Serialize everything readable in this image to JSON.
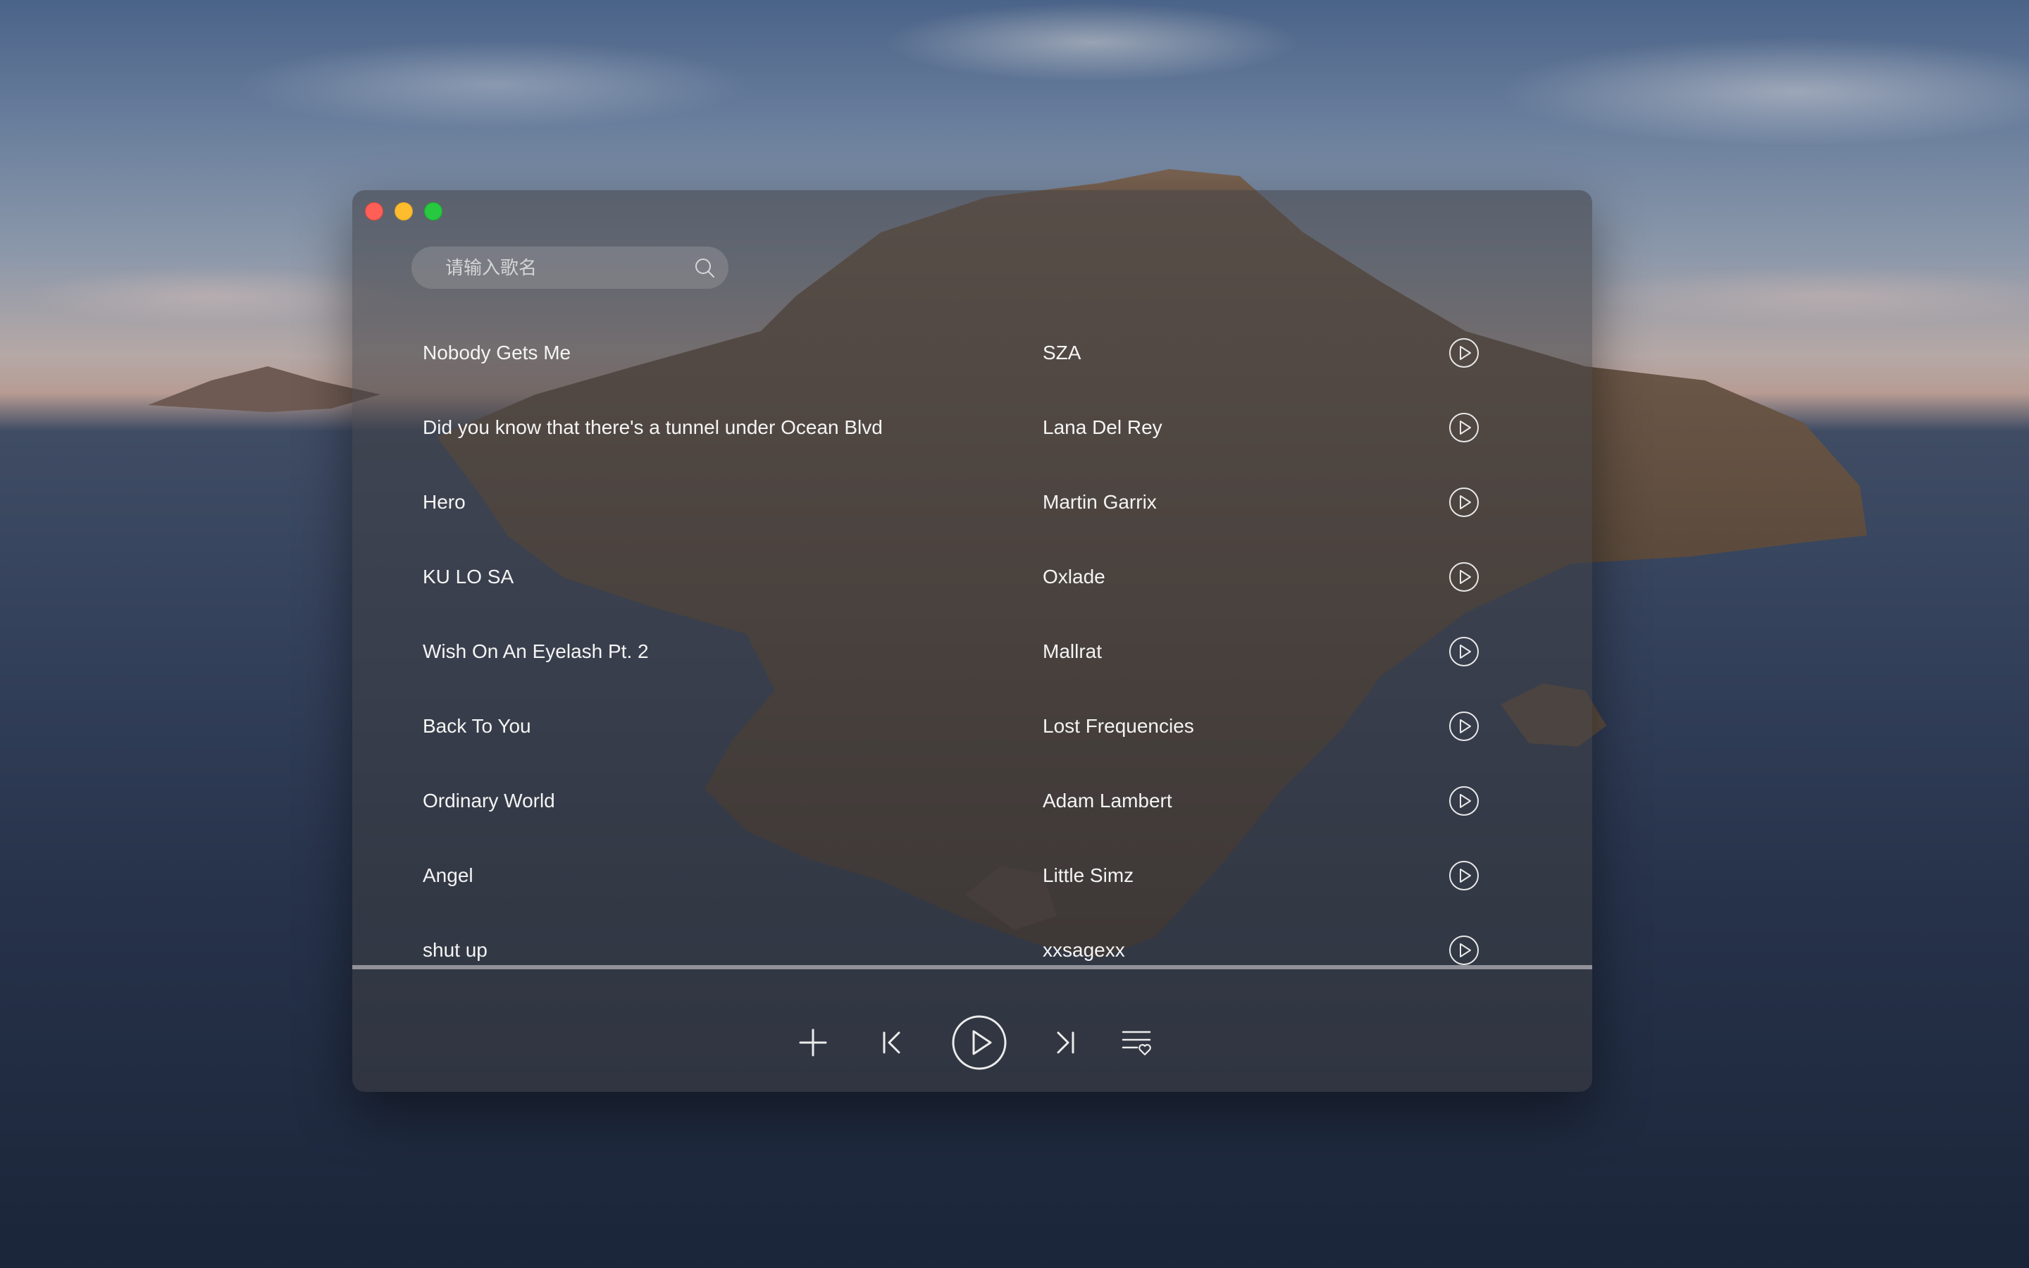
{
  "window": {
    "traffic_lights": [
      "close",
      "minimize",
      "zoom"
    ]
  },
  "search": {
    "placeholder": "请输入歌名",
    "value": "",
    "icon": "search-icon"
  },
  "songs": [
    {
      "title": "Nobody Gets Me",
      "artist": "SZA"
    },
    {
      "title": "Did you know that there's a tunnel under Ocean Blvd",
      "artist": "Lana Del Rey"
    },
    {
      "title": "Hero",
      "artist": "Martin Garrix"
    },
    {
      "title": "KU LO SA",
      "artist": "Oxlade"
    },
    {
      "title": "Wish On An Eyelash Pt. 2",
      "artist": "Mallrat"
    },
    {
      "title": "Back To You",
      "artist": "Lost Frequencies"
    },
    {
      "title": "Ordinary World",
      "artist": "Adam Lambert"
    },
    {
      "title": "Angel",
      "artist": "Little Simz"
    },
    {
      "title": "shut up",
      "artist": "xxsagexx"
    }
  ],
  "row_icon": "play-circle-icon",
  "controls": [
    "add-icon",
    "previous-icon",
    "play-icon",
    "next-icon",
    "playlist-favorite-icon"
  ],
  "colors": {
    "text": "#f4f4f4",
    "close": "#ff5f57",
    "minimize": "#febc2e",
    "zoom": "#28c840"
  }
}
